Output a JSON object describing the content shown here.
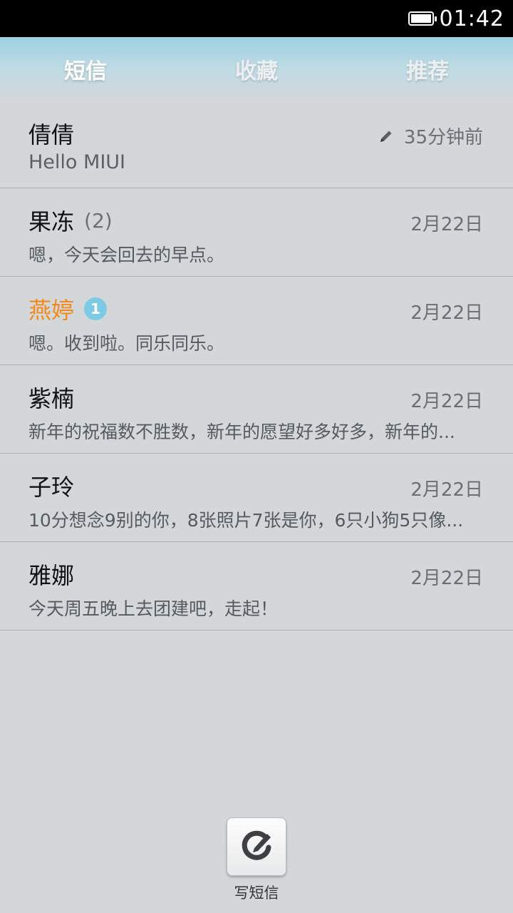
{
  "status_bar": {
    "time": "01:42",
    "battery_level": 0.95
  },
  "tabs": [
    {
      "label": "短信",
      "active": true
    },
    {
      "label": "收藏",
      "active": false
    },
    {
      "label": "推荐",
      "active": false
    }
  ],
  "conversations": [
    {
      "name": "倩倩",
      "count": "",
      "unread": "",
      "preview": "Hello MIUI",
      "time": "35分钟前",
      "draft": true
    },
    {
      "name": "果冻",
      "count": "(2)",
      "unread": "",
      "preview": "嗯，今天会回去的早点。",
      "time": "2月22日",
      "draft": false
    },
    {
      "name": "燕婷",
      "count": "",
      "unread": "1",
      "preview": "嗯。收到啦。同乐同乐。",
      "time": "2月22日",
      "draft": false
    },
    {
      "name": "紫楠",
      "count": "",
      "unread": "",
      "preview": "新年的祝福数不胜数，新年的愿望好多好多，新年的...",
      "time": "2月22日",
      "draft": false
    },
    {
      "name": "子玲",
      "count": "",
      "unread": "",
      "preview": "10分想念9别的你，8张照片7张是你，6只小狗5只像...",
      "time": "2月22日",
      "draft": false
    },
    {
      "name": "雅娜",
      "count": "",
      "unread": "",
      "preview": "今天周五晚上去团建吧，走起！",
      "time": "2月22日",
      "draft": false
    }
  ],
  "compose": {
    "label": "写短信",
    "icon": "compose-icon"
  },
  "colors": {
    "unread_name": "#f28a1a",
    "badge": "#7ccbe4",
    "tab_bar_top": "#9dd0e1"
  }
}
